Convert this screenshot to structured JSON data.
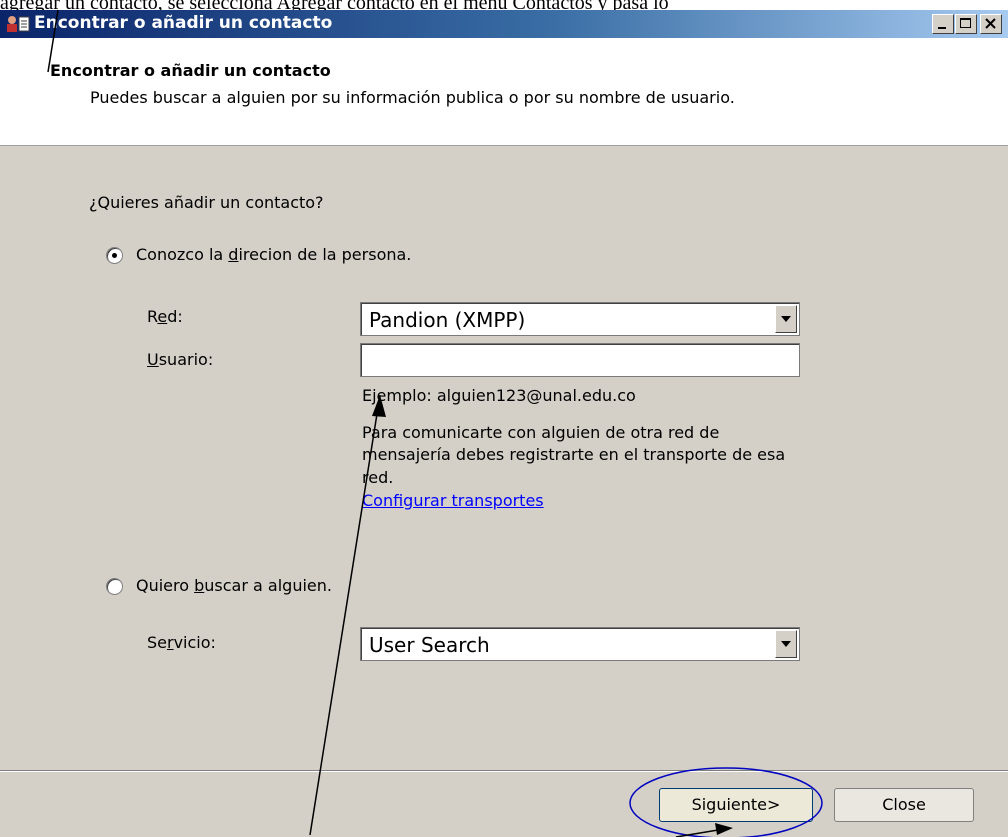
{
  "doc_text": "agregar un contacto, se selecciona Agregar contacto en el menú Contactos y pasa lo",
  "window": {
    "title": "Encontrar o añadir un contacto"
  },
  "header": {
    "title": "Encontrar o añadir un contacto",
    "description": "Puedes buscar a alguien por su información publica o por su nombre de usuario."
  },
  "form": {
    "question": "¿Quieres añadir un contacto?",
    "option_known": {
      "before": "Conozco la ",
      "accel": "d",
      "after": "irecion de la persona.",
      "selected": true
    },
    "red_label": {
      "before": "R",
      "accel": "e",
      "after": "d:"
    },
    "red_value": "Pandion (XMPP)",
    "usuario_label": {
      "accel": "U",
      "after": "suario:"
    },
    "usuario_value": "",
    "example": "Ejemplo: alguien123@unal.edu.co",
    "info_lines": [
      "Para comunicarte con alguien de otra red de",
      "mensajería debes registrarte en el transporte de esa",
      "red."
    ],
    "config_link": "Configurar transportes",
    "option_search": {
      "before": "Quiero ",
      "accel": "b",
      "after": "uscar a alguien.",
      "selected": false
    },
    "servicio_label": {
      "before": "Se",
      "accel": "r",
      "after": "vicio:"
    },
    "servicio_value": "User Search"
  },
  "buttons": {
    "next": "Siguiente>",
    "close": "Close"
  },
  "colors": {
    "annotation": "#0000c0",
    "titlebar_start": "#0a246a",
    "dialog_bg": "#d4d0c8"
  }
}
